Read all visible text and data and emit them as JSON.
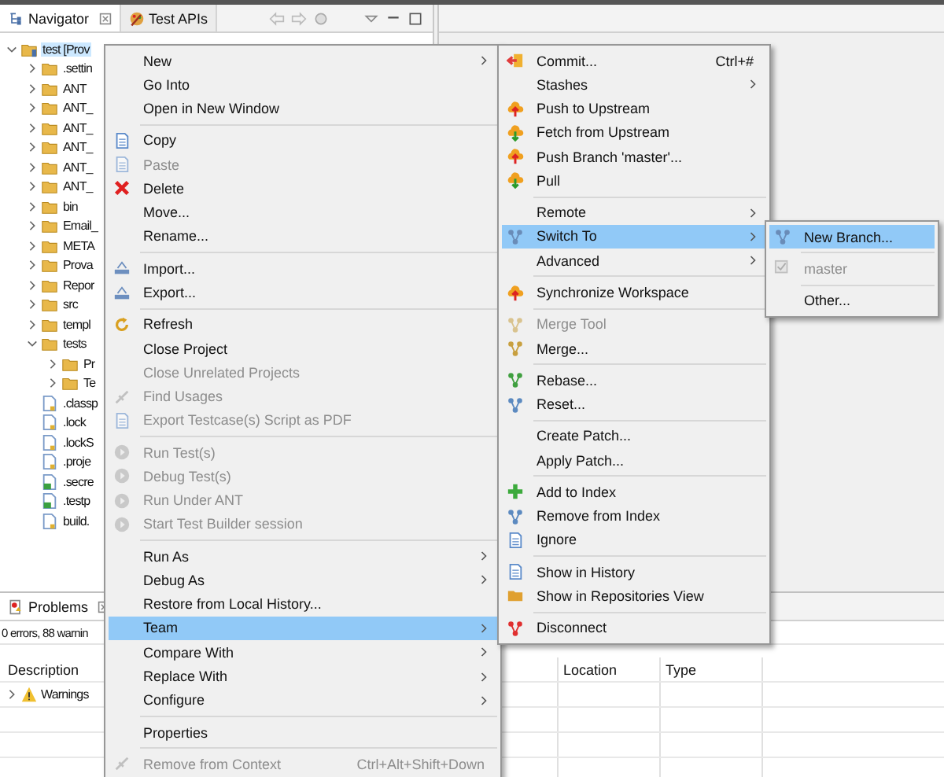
{
  "navigator": {
    "tabs": [
      {
        "label": "Navigator",
        "selected": true,
        "closable": true
      },
      {
        "label": "Test APIs",
        "selected": false,
        "closable": false
      }
    ],
    "tree": [
      {
        "label": "test [Prov",
        "kind": "project",
        "expanded": true,
        "selected": true,
        "children": [
          {
            "label": ".settin",
            "kind": "folder",
            "expanded": false,
            "selected": false
          },
          {
            "label": "ANT",
            "kind": "folder",
            "expanded": false,
            "selected": false
          },
          {
            "label": "ANT_",
            "kind": "folder",
            "expanded": false,
            "selected": false
          },
          {
            "label": "ANT_",
            "kind": "folder",
            "expanded": false,
            "selected": false
          },
          {
            "label": "ANT_",
            "kind": "folder",
            "expanded": false,
            "selected": false
          },
          {
            "label": "ANT_",
            "kind": "folder",
            "expanded": false,
            "selected": false
          },
          {
            "label": "ANT_",
            "kind": "folder",
            "expanded": false,
            "selected": false
          },
          {
            "label": "bin",
            "kind": "folder",
            "expanded": false,
            "selected": false
          },
          {
            "label": "Email_",
            "kind": "folder",
            "expanded": false,
            "selected": false
          },
          {
            "label": "META",
            "kind": "folder",
            "expanded": false,
            "selected": false
          },
          {
            "label": "Prova",
            "kind": "folder",
            "expanded": false,
            "selected": false
          },
          {
            "label": "Repor",
            "kind": "folder",
            "expanded": false,
            "selected": false
          },
          {
            "label": "src",
            "kind": "folder",
            "expanded": false,
            "selected": false
          },
          {
            "label": "templ",
            "kind": "folder",
            "expanded": false,
            "selected": false
          },
          {
            "label": "tests",
            "kind": "folder",
            "expanded": true,
            "selected": false,
            "children": [
              {
                "label": "Pr",
                "kind": "folder",
                "expanded": false,
                "selected": false
              },
              {
                "label": "Te",
                "kind": "folder",
                "expanded": false,
                "selected": false
              }
            ]
          },
          {
            "label": ".classp",
            "kind": "file",
            "selected": false
          },
          {
            "label": ".lock",
            "kind": "file",
            "selected": false
          },
          {
            "label": ".lockS",
            "kind": "file",
            "selected": false
          },
          {
            "label": ".proje",
            "kind": "file",
            "selected": false
          },
          {
            "label": ".secre",
            "kind": "script",
            "selected": false
          },
          {
            "label": ".testp",
            "kind": "script",
            "selected": false
          },
          {
            "label": "build.",
            "kind": "file",
            "selected": false
          }
        ]
      }
    ]
  },
  "problems": {
    "tab": {
      "label": "Problems",
      "selected": true
    },
    "summary": "0 errors, 88 warnin",
    "columns": [
      {
        "label": "Description"
      },
      {
        "label": "Location"
      },
      {
        "label": "Type"
      }
    ],
    "rows": [
      {
        "label": "Warnings",
        "expanded": false
      }
    ]
  },
  "context_menu": {
    "sections": [
      {
        "items": [
          {
            "label": "New",
            "disabled": false,
            "selected": false,
            "submenu": true
          },
          {
            "label": "Go Into",
            "disabled": false,
            "selected": false,
            "submenu": false
          },
          {
            "label": "Open in New Window",
            "disabled": false,
            "selected": false,
            "submenu": false
          }
        ]
      },
      {
        "items": [
          {
            "label": "Copy",
            "disabled": false,
            "selected": false,
            "submenu": false
          },
          {
            "label": "Paste",
            "disabled": true,
            "selected": false,
            "submenu": false
          },
          {
            "label": "Delete",
            "disabled": false,
            "selected": false,
            "submenu": false
          },
          {
            "label": "Move...",
            "disabled": false,
            "selected": false,
            "submenu": false
          },
          {
            "label": "Rename...",
            "disabled": false,
            "selected": false,
            "submenu": false
          }
        ]
      },
      {
        "items": [
          {
            "label": "Import...",
            "disabled": false,
            "selected": false,
            "submenu": false
          },
          {
            "label": "Export...",
            "disabled": false,
            "selected": false,
            "submenu": false
          }
        ]
      },
      {
        "items": [
          {
            "label": "Refresh",
            "disabled": false,
            "selected": false,
            "submenu": false
          },
          {
            "label": "Close Project",
            "disabled": false,
            "selected": false,
            "submenu": false
          },
          {
            "label": "Close Unrelated Projects",
            "disabled": true,
            "selected": false,
            "submenu": false
          },
          {
            "label": "Find Usages",
            "disabled": true,
            "selected": false,
            "submenu": false
          },
          {
            "label": "Export Testcase(s) Script as PDF",
            "disabled": true,
            "selected": false,
            "submenu": false
          }
        ]
      },
      {
        "items": [
          {
            "label": "Run Test(s)",
            "disabled": true,
            "selected": false,
            "submenu": false
          },
          {
            "label": "Debug Test(s)",
            "disabled": true,
            "selected": false,
            "submenu": false
          },
          {
            "label": "Run Under ANT",
            "disabled": true,
            "selected": false,
            "submenu": false
          },
          {
            "label": "Start Test Builder session",
            "disabled": true,
            "selected": false,
            "submenu": false
          }
        ]
      },
      {
        "items": [
          {
            "label": "Run As",
            "disabled": false,
            "selected": false,
            "submenu": true
          },
          {
            "label": "Debug As",
            "disabled": false,
            "selected": false,
            "submenu": true
          },
          {
            "label": "Restore from Local History...",
            "disabled": false,
            "selected": false,
            "submenu": false
          },
          {
            "label": "Team",
            "disabled": false,
            "selected": true,
            "submenu": true
          },
          {
            "label": "Compare With",
            "disabled": false,
            "selected": false,
            "submenu": true
          },
          {
            "label": "Replace With",
            "disabled": false,
            "selected": false,
            "submenu": true
          },
          {
            "label": "Configure",
            "disabled": false,
            "selected": false,
            "submenu": true
          }
        ]
      },
      {
        "items": [
          {
            "label": "Properties",
            "disabled": false,
            "selected": false,
            "submenu": false
          }
        ]
      },
      {
        "items": [
          {
            "label": "Remove from Context",
            "shortcut": "Ctrl+Alt+Shift+Down",
            "disabled": true,
            "selected": false,
            "submenu": false
          }
        ]
      }
    ]
  },
  "team_menu": {
    "sections": [
      {
        "items": [
          {
            "label": "Commit...",
            "shortcut": "Ctrl+#",
            "disabled": false,
            "selected": false,
            "submenu": false
          },
          {
            "label": "Stashes",
            "disabled": false,
            "selected": false,
            "submenu": true
          },
          {
            "label": "Push to Upstream",
            "disabled": false,
            "selected": false,
            "submenu": false
          },
          {
            "label": "Fetch from Upstream",
            "disabled": false,
            "selected": false,
            "submenu": false
          },
          {
            "label": "Push Branch 'master'...",
            "disabled": false,
            "selected": false,
            "submenu": false
          },
          {
            "label": "Pull",
            "disabled": false,
            "selected": false,
            "submenu": false
          }
        ]
      },
      {
        "items": [
          {
            "label": "Remote",
            "disabled": false,
            "selected": false,
            "submenu": true
          },
          {
            "label": "Switch To",
            "disabled": false,
            "selected": true,
            "submenu": true
          },
          {
            "label": "Advanced",
            "disabled": false,
            "selected": false,
            "submenu": true
          }
        ]
      },
      {
        "items": [
          {
            "label": "Synchronize Workspace",
            "disabled": false,
            "selected": false,
            "submenu": false
          }
        ]
      },
      {
        "items": [
          {
            "label": "Merge Tool",
            "disabled": true,
            "selected": false,
            "submenu": false
          },
          {
            "label": "Merge...",
            "disabled": false,
            "selected": false,
            "submenu": false
          }
        ]
      },
      {
        "items": [
          {
            "label": "Rebase...",
            "disabled": false,
            "selected": false,
            "submenu": false
          },
          {
            "label": "Reset...",
            "disabled": false,
            "selected": false,
            "submenu": false
          }
        ]
      },
      {
        "items": [
          {
            "label": "Create Patch...",
            "disabled": false,
            "selected": false,
            "submenu": false
          },
          {
            "label": "Apply Patch...",
            "disabled": false,
            "selected": false,
            "submenu": false
          }
        ]
      },
      {
        "items": [
          {
            "label": "Add to Index",
            "disabled": false,
            "selected": false,
            "submenu": false
          },
          {
            "label": "Remove from Index",
            "disabled": false,
            "selected": false,
            "submenu": false
          },
          {
            "label": "Ignore",
            "disabled": false,
            "selected": false,
            "submenu": false
          }
        ]
      },
      {
        "items": [
          {
            "label": "Show in History",
            "disabled": false,
            "selected": false,
            "submenu": false
          },
          {
            "label": "Show in Repositories View",
            "disabled": false,
            "selected": false,
            "submenu": false
          }
        ]
      },
      {
        "items": [
          {
            "label": "Disconnect",
            "disabled": false,
            "selected": false,
            "submenu": false
          }
        ]
      }
    ]
  },
  "switch_menu": {
    "sections": [
      {
        "items": [
          {
            "label": "New Branch...",
            "disabled": false,
            "selected": true,
            "submenu": false
          }
        ]
      },
      {
        "items": [
          {
            "label": "master",
            "disabled": true,
            "selected": false,
            "submenu": false
          }
        ]
      },
      {
        "items": [
          {
            "label": "Other...",
            "disabled": false,
            "selected": false,
            "submenu": false
          }
        ]
      }
    ]
  }
}
